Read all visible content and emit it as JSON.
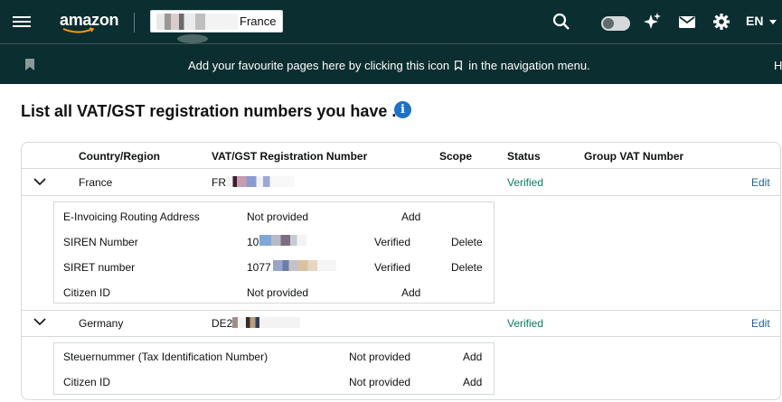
{
  "topbar": {
    "logo": "amazon",
    "marketplace": "France",
    "language": "EN",
    "icons": [
      "menu-icon",
      "search-icon",
      "sparkle-icon",
      "mail-icon",
      "gear-icon"
    ]
  },
  "bookmark_bar": {
    "text_before": "Add your favourite pages here by clicking this icon",
    "text_after": "in the navigation menu.",
    "edge_text": "H"
  },
  "page": {
    "title": "List all VAT/GST registration numbers you have .",
    "info": "i"
  },
  "table": {
    "headers": {
      "country": "Country/Region",
      "vat": "VAT/GST Registration Number",
      "scope": "Scope",
      "status": "Status",
      "group": "Group VAT Number"
    },
    "rows": [
      {
        "country": "France",
        "vat_prefix": "FR",
        "status": "Verified",
        "action": "Edit",
        "details": [
          {
            "label": "E-Invoicing Routing Address",
            "value": "Not provided",
            "status": "",
            "action": "Add"
          },
          {
            "label": "SIREN Number",
            "value": "10",
            "status": "Verified",
            "action": "Delete"
          },
          {
            "label": "SIRET number",
            "value": "1077",
            "status": "Verified",
            "action": "Delete"
          },
          {
            "label": "Citizen ID",
            "value": "Not provided",
            "status": "",
            "action": "Add"
          }
        ]
      },
      {
        "country": "Germany",
        "vat_prefix": "DE2",
        "status": "Verified",
        "action": "Edit",
        "details": [
          {
            "label": "Steuernummer (Tax Identification Number)",
            "value": "Not provided",
            "action": "Add"
          },
          {
            "label": "Citizen ID",
            "value": "Not provided",
            "action": "Add"
          }
        ]
      }
    ]
  },
  "colors": {
    "header_bg": "#0b2e30",
    "verified": "#067d62",
    "link": "#2162a1",
    "info": "#1a73c8"
  }
}
